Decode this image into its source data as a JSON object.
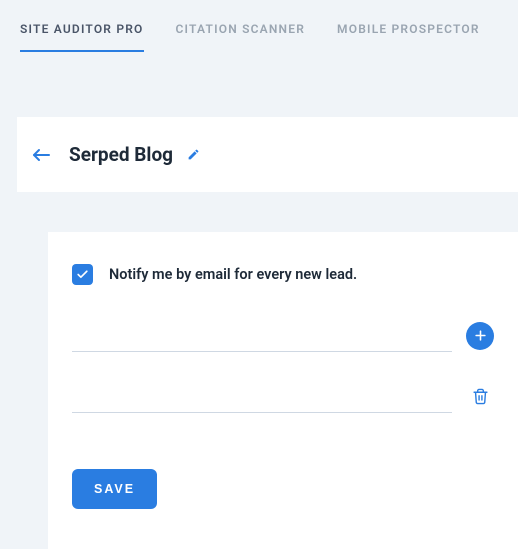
{
  "tabs": [
    {
      "label": "SITE AUDITOR PRO",
      "active": true
    },
    {
      "label": "CITATION SCANNER",
      "active": false
    },
    {
      "label": "MOBILE PROSPECTOR",
      "active": false
    }
  ],
  "header": {
    "title": "Serped Blog"
  },
  "settings": {
    "notify_label": "Notify me by email for every new lead.",
    "notify_checked": true,
    "inputs": [
      {
        "value": ""
      },
      {
        "value": ""
      }
    ],
    "save_label": "SAVE"
  }
}
